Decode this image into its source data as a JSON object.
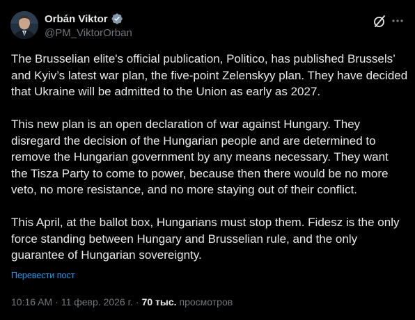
{
  "author": {
    "display_name": "Orbán Viktor",
    "handle": "@PM_ViktorOrban",
    "verified": true,
    "avatar_icon": "avatar-portrait-icon"
  },
  "actions": {
    "grok_icon": "grok-slash-icon",
    "more_icon": "more-ellipsis-icon"
  },
  "post": {
    "paragraphs": [
      "The Brusselian elite's official publication, Politico, has published Brussels’ and Kyiv’s latest war plan, the five-point Zelenskyy plan. They have decided that Ukraine will be admitted to the Union as early as 2027.",
      "This new plan is an open declaration of war against Hungary. They disregard the decision of the Hungarian people and are determined to remove the Hungarian government by any means necessary. They want the Tisza Party to come to power, because then there would be no more veto, no more resistance, and no more staying out of their conflict.",
      "This April, at the ballot box, Hungarians must stop them. Fidesz is the only force standing between Hungary and Brusselian rule, and the only guarantee of Hungarian sovereignty."
    ],
    "translate_label": "Перевести пост"
  },
  "meta": {
    "time": "10:16 AM",
    "separator": "·",
    "date": "11 февр. 2026 г.",
    "views_count": "70 тыс.",
    "views_label": "просмотров"
  },
  "colors": {
    "background": "#000000",
    "text": "#e7e9ea",
    "muted": "#71767b",
    "accent": "#1d9bf0"
  }
}
